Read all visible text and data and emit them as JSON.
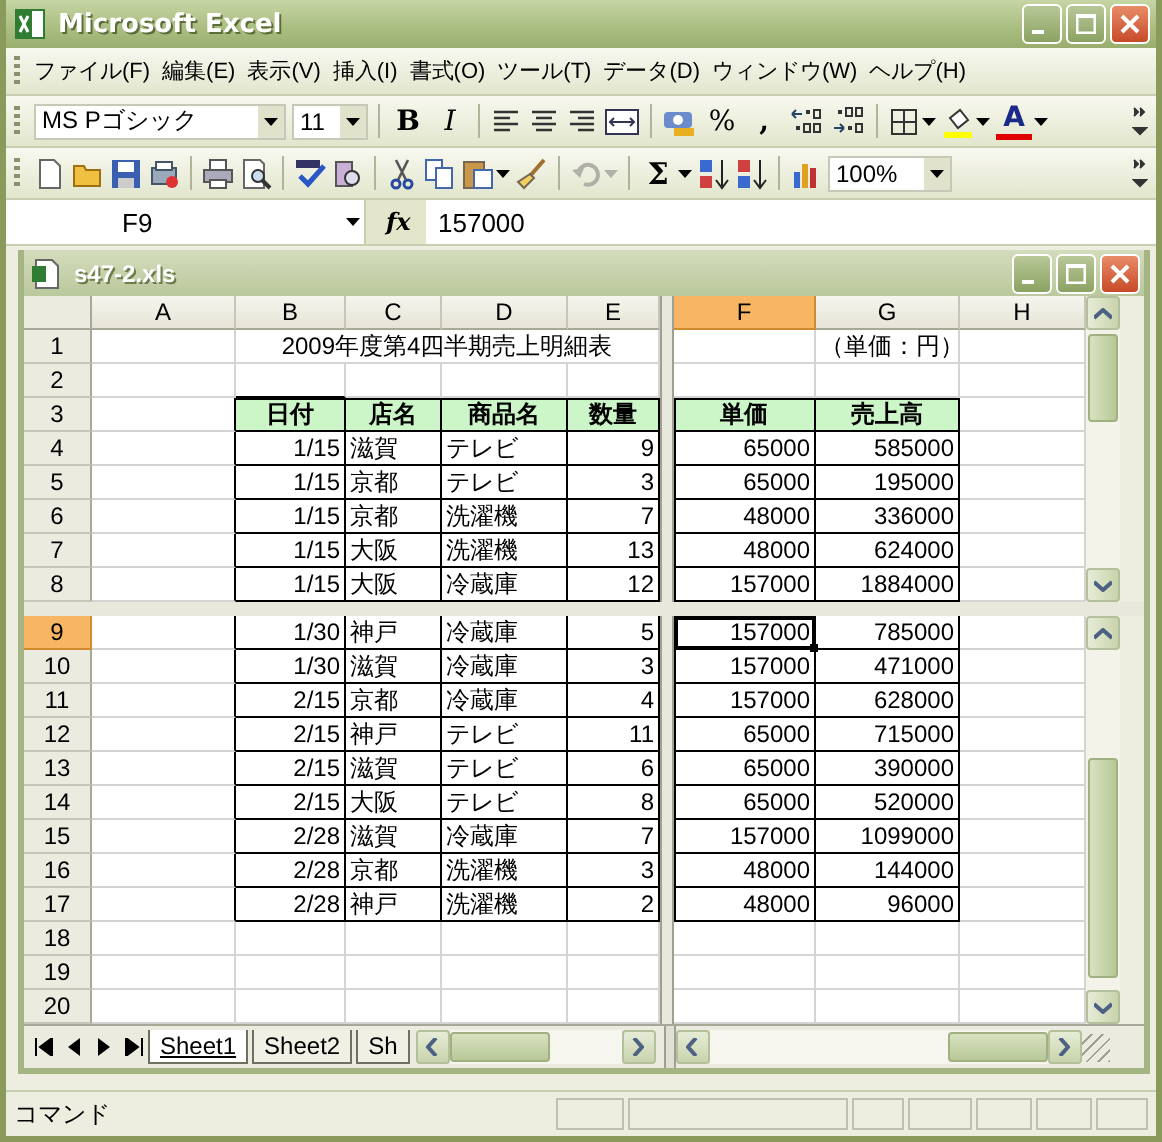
{
  "window": {
    "title": "Microsoft Excel"
  },
  "menu": [
    "ファイル(F)",
    "編集(E)",
    "表示(V)",
    "挿入(I)",
    "書式(O)",
    "ツール(T)",
    "データ(D)",
    "ウィンドウ(W)",
    "ヘルプ(H)"
  ],
  "formatting_toolbar": {
    "font": "MS Pゴシック",
    "size": "11",
    "bold_label": "B",
    "italic_label": "I",
    "percent_label": "%",
    "comma_label": ",",
    "font_color_label": "A"
  },
  "standard_toolbar": {
    "undo_disabled": true,
    "sum_label": "Σ",
    "zoom": "100%"
  },
  "formula_bar": {
    "name_box": "F9",
    "fx_label": "fx",
    "formula": "157000"
  },
  "workbook": {
    "title": "s47-2.xls"
  },
  "columns": [
    {
      "label": "A",
      "selected": false
    },
    {
      "label": "B",
      "selected": false
    },
    {
      "label": "C",
      "selected": false
    },
    {
      "label": "D",
      "selected": false
    },
    {
      "label": "E",
      "selected": false
    },
    {
      "label": "F",
      "selected": true
    },
    {
      "label": "G",
      "selected": false
    },
    {
      "label": "H",
      "selected": false
    }
  ],
  "panes": [
    {
      "rows": [
        {
          "label": "1",
          "selected": false,
          "kind": "title",
          "title": "2009年度第4四半期売上明細表",
          "note": "（単価：円）"
        },
        {
          "label": "2",
          "selected": false,
          "kind": "blank"
        },
        {
          "label": "3",
          "selected": false,
          "kind": "header",
          "cells": [
            "日付",
            "店名",
            "商品名",
            "数量",
            "単価",
            "売上高"
          ]
        },
        {
          "label": "4",
          "selected": false,
          "kind": "data",
          "cells": [
            "1/15",
            "滋賀",
            "テレビ",
            "9",
            "65000",
            "585000"
          ]
        },
        {
          "label": "5",
          "selected": false,
          "kind": "data",
          "cells": [
            "1/15",
            "京都",
            "テレビ",
            "3",
            "65000",
            "195000"
          ]
        },
        {
          "label": "6",
          "selected": false,
          "kind": "data",
          "cells": [
            "1/15",
            "京都",
            "洗濯機",
            "7",
            "48000",
            "336000"
          ]
        },
        {
          "label": "7",
          "selected": false,
          "kind": "data",
          "cells": [
            "1/15",
            "大阪",
            "洗濯機",
            "13",
            "48000",
            "624000"
          ]
        },
        {
          "label": "8",
          "selected": false,
          "kind": "data",
          "cells": [
            "1/15",
            "大阪",
            "冷蔵庫",
            "12",
            "157000",
            "1884000"
          ]
        }
      ]
    },
    {
      "rows": [
        {
          "label": "9",
          "selected": true,
          "kind": "data",
          "cells": [
            "1/30",
            "神戸",
            "冷蔵庫",
            "5",
            "157000",
            "785000"
          ]
        },
        {
          "label": "10",
          "selected": false,
          "kind": "data",
          "cells": [
            "1/30",
            "滋賀",
            "冷蔵庫",
            "3",
            "157000",
            "471000"
          ]
        },
        {
          "label": "11",
          "selected": false,
          "kind": "data",
          "cells": [
            "2/15",
            "京都",
            "冷蔵庫",
            "4",
            "157000",
            "628000"
          ]
        },
        {
          "label": "12",
          "selected": false,
          "kind": "data",
          "cells": [
            "2/15",
            "神戸",
            "テレビ",
            "11",
            "65000",
            "715000"
          ]
        },
        {
          "label": "13",
          "selected": false,
          "kind": "data",
          "cells": [
            "2/15",
            "滋賀",
            "テレビ",
            "6",
            "65000",
            "390000"
          ]
        },
        {
          "label": "14",
          "selected": false,
          "kind": "data",
          "cells": [
            "2/15",
            "大阪",
            "テレビ",
            "8",
            "65000",
            "520000"
          ]
        },
        {
          "label": "15",
          "selected": false,
          "kind": "data",
          "cells": [
            "2/28",
            "滋賀",
            "冷蔵庫",
            "7",
            "157000",
            "1099000"
          ]
        },
        {
          "label": "16",
          "selected": false,
          "kind": "data",
          "cells": [
            "2/28",
            "京都",
            "洗濯機",
            "3",
            "48000",
            "144000"
          ]
        },
        {
          "label": "17",
          "selected": false,
          "kind": "data",
          "cells": [
            "2/28",
            "神戸",
            "洗濯機",
            "2",
            "48000",
            "96000"
          ]
        },
        {
          "label": "18",
          "selected": false,
          "kind": "blank"
        },
        {
          "label": "19",
          "selected": false,
          "kind": "blank"
        },
        {
          "label": "20",
          "selected": false,
          "kind": "blank"
        }
      ]
    }
  ],
  "sheet_tabs": [
    {
      "label": "Sheet1",
      "selected": true
    },
    {
      "label": "Sheet2",
      "selected": false
    },
    {
      "label": "Sh",
      "selected": false
    }
  ],
  "status_bar": {
    "text": "コマンド"
  }
}
